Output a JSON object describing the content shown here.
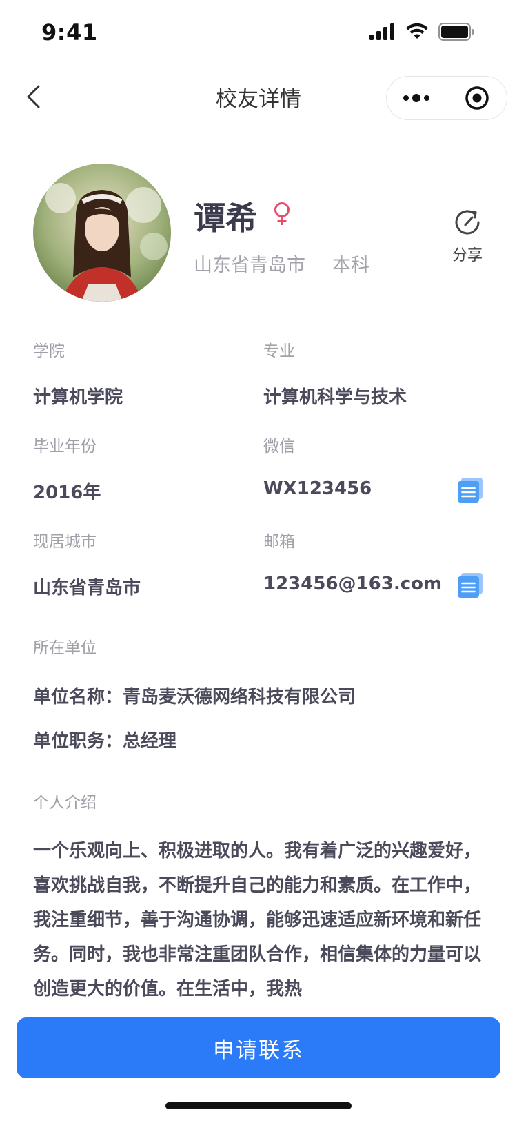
{
  "status_bar": {
    "time": "9:41"
  },
  "nav": {
    "title": "校友详情"
  },
  "profile": {
    "name": "谭希",
    "location": "山东省青岛市",
    "degree": "本科",
    "share_label": "分享"
  },
  "fields": {
    "college": {
      "label": "学院",
      "value": "计算机学院"
    },
    "major": {
      "label": "专业",
      "value": "计算机科学与技术"
    },
    "grad_year": {
      "label": "毕业年份",
      "value": "2016年"
    },
    "wechat": {
      "label": "微信",
      "value": "WX123456"
    },
    "city": {
      "label": "现居城市",
      "value": "山东省青岛市"
    },
    "email": {
      "label": "邮箱",
      "value": "123456@163.com"
    }
  },
  "employer": {
    "section_label": "所在单位",
    "company_key": "单位名称：",
    "company_value": "青岛麦沃德网络科技有限公司",
    "position_key": "单位职务：",
    "position_value": "总经理"
  },
  "intro": {
    "section_label": "个人介绍",
    "text": "一个乐观向上、积极进取的人。我有着广泛的兴趣爱好，喜欢挑战自我，不断提升自己的能力和素质。在工作中，我注重细节，善于沟通协调，能够迅速适应新环境和新任务。同时，我也非常注重团队合作，相信集体的力量可以创造更大的价值。在生活中，我热"
  },
  "actions": {
    "apply_label": "申请联系"
  },
  "colors": {
    "primary": "#2b7af7",
    "gender_female": "#e84c6a",
    "copy_icon": "#4d9ef7"
  }
}
